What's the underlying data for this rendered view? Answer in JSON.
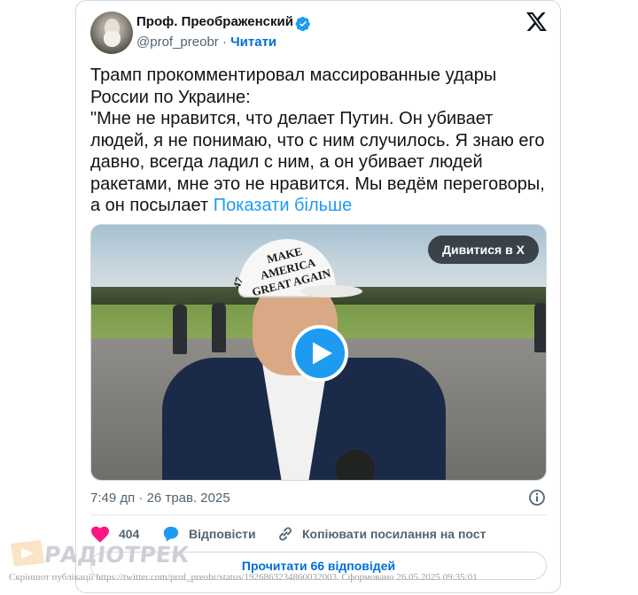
{
  "author": {
    "name": "Проф. Преображенский",
    "handle": "@prof_preobr",
    "separator": "·",
    "follow_label": "Читати"
  },
  "tweet": {
    "lines": [
      "Трамп прокомментировал массированные удары России по Украине:",
      "\"Мне не нравится, что делает Путин. Он убивает людей, я не понимаю, что с ним случилось. Я знаю его давно, всегда ладил с ним, а он убивает людей ракетами, мне это не нравится. Мы ведём переговоры, а он посылает"
    ],
    "show_more_label": "Показати більше"
  },
  "media": {
    "watch_label": "Дивитися в X",
    "hat_text": "MAKE AMERICA GREAT AGAIN",
    "hat_number": "47"
  },
  "meta": {
    "time": "7:49 дп",
    "separator": "·",
    "date": "26 трав. 2025"
  },
  "actions": {
    "like_count": "404",
    "reply_label": "Відповісти",
    "copy_link_label": "Копіювати посилання на пост",
    "read_replies_label": "Прочитати 66 відповідей"
  },
  "watermark": {
    "brand": "РАДІОТРЕК",
    "footer": "Скріншот публікації https://twitter.com/prof_preobr/status/1926863234860032003. Сформовано 26.05.2025 09:35:01"
  },
  "colors": {
    "link": "#1d9bf0",
    "follow": "#006fd6",
    "text": "#0f1419",
    "muted": "#536471",
    "like": "#f91880"
  }
}
